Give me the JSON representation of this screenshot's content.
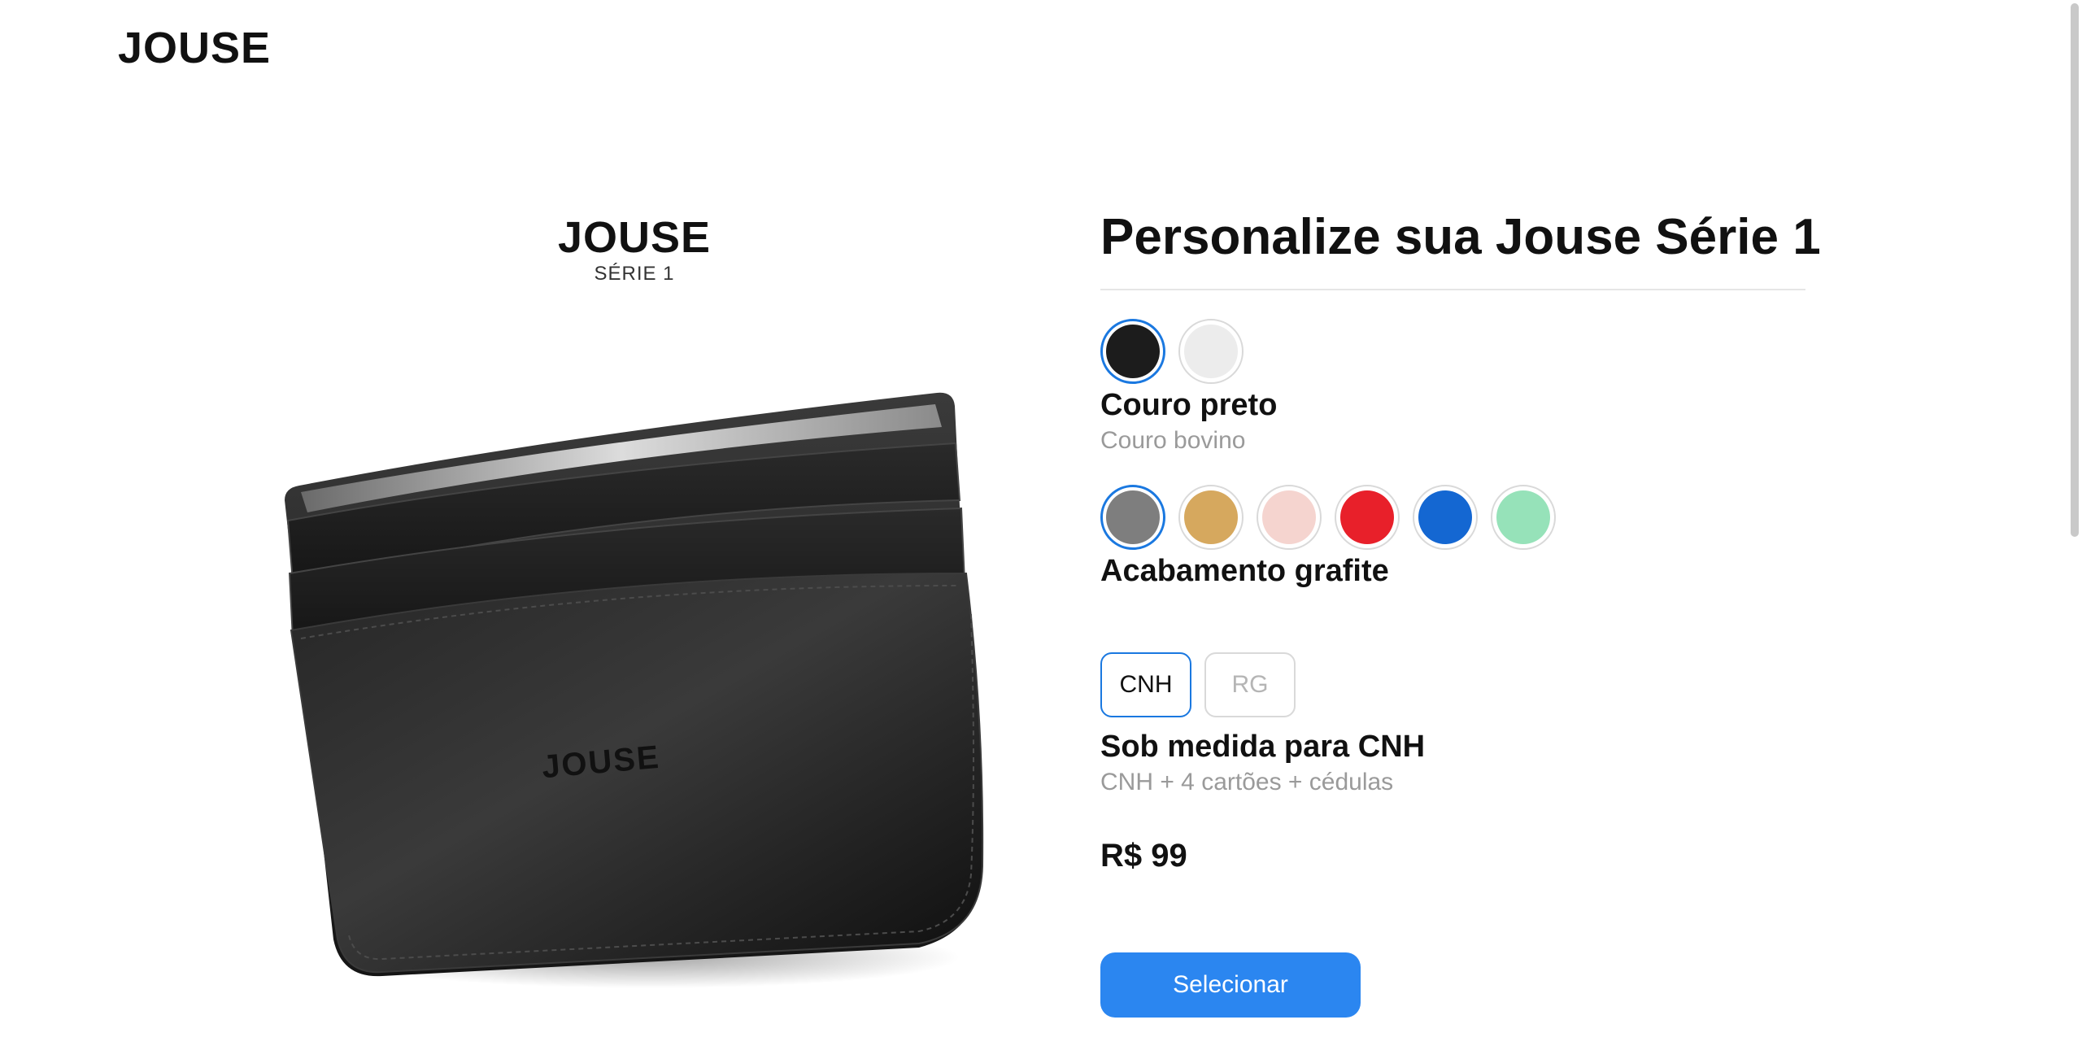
{
  "header": {
    "logo_text": "JOUSE"
  },
  "product": {
    "brand": "JOUSE",
    "series": "SÉRIE 1",
    "embossed_logo": "JOUSE"
  },
  "config": {
    "title": "Personalize sua Jouse Série 1",
    "material": {
      "swatches": [
        {
          "name": "black-leather",
          "color": "#1c1c1c",
          "selected": true
        },
        {
          "name": "white-leather",
          "color": "#ececec",
          "selected": false
        }
      ],
      "selected_name": "Couro preto",
      "selected_desc": "Couro bovino"
    },
    "finish": {
      "swatches": [
        {
          "name": "graphite",
          "color": "#7e7e7e",
          "selected": true
        },
        {
          "name": "gold",
          "color": "#d6a85e",
          "selected": false
        },
        {
          "name": "rose",
          "color": "#f5d4cf",
          "selected": false
        },
        {
          "name": "red",
          "color": "#e8202a",
          "selected": false
        },
        {
          "name": "blue",
          "color": "#1467d2",
          "selected": false
        },
        {
          "name": "mint",
          "color": "#96e2b9",
          "selected": false
        }
      ],
      "selected_name": "Acabamento grafite"
    },
    "size": {
      "options": [
        {
          "label": "CNH",
          "selected": true
        },
        {
          "label": "RG",
          "selected": false
        }
      ],
      "selected_name": "Sob medida para CNH",
      "selected_desc": "CNH + 4 cartões + cédulas"
    },
    "price": "R$ 99",
    "button_label": "Selecionar"
  },
  "colors": {
    "accent": "#1a78e0",
    "button": "#2b86f0"
  }
}
